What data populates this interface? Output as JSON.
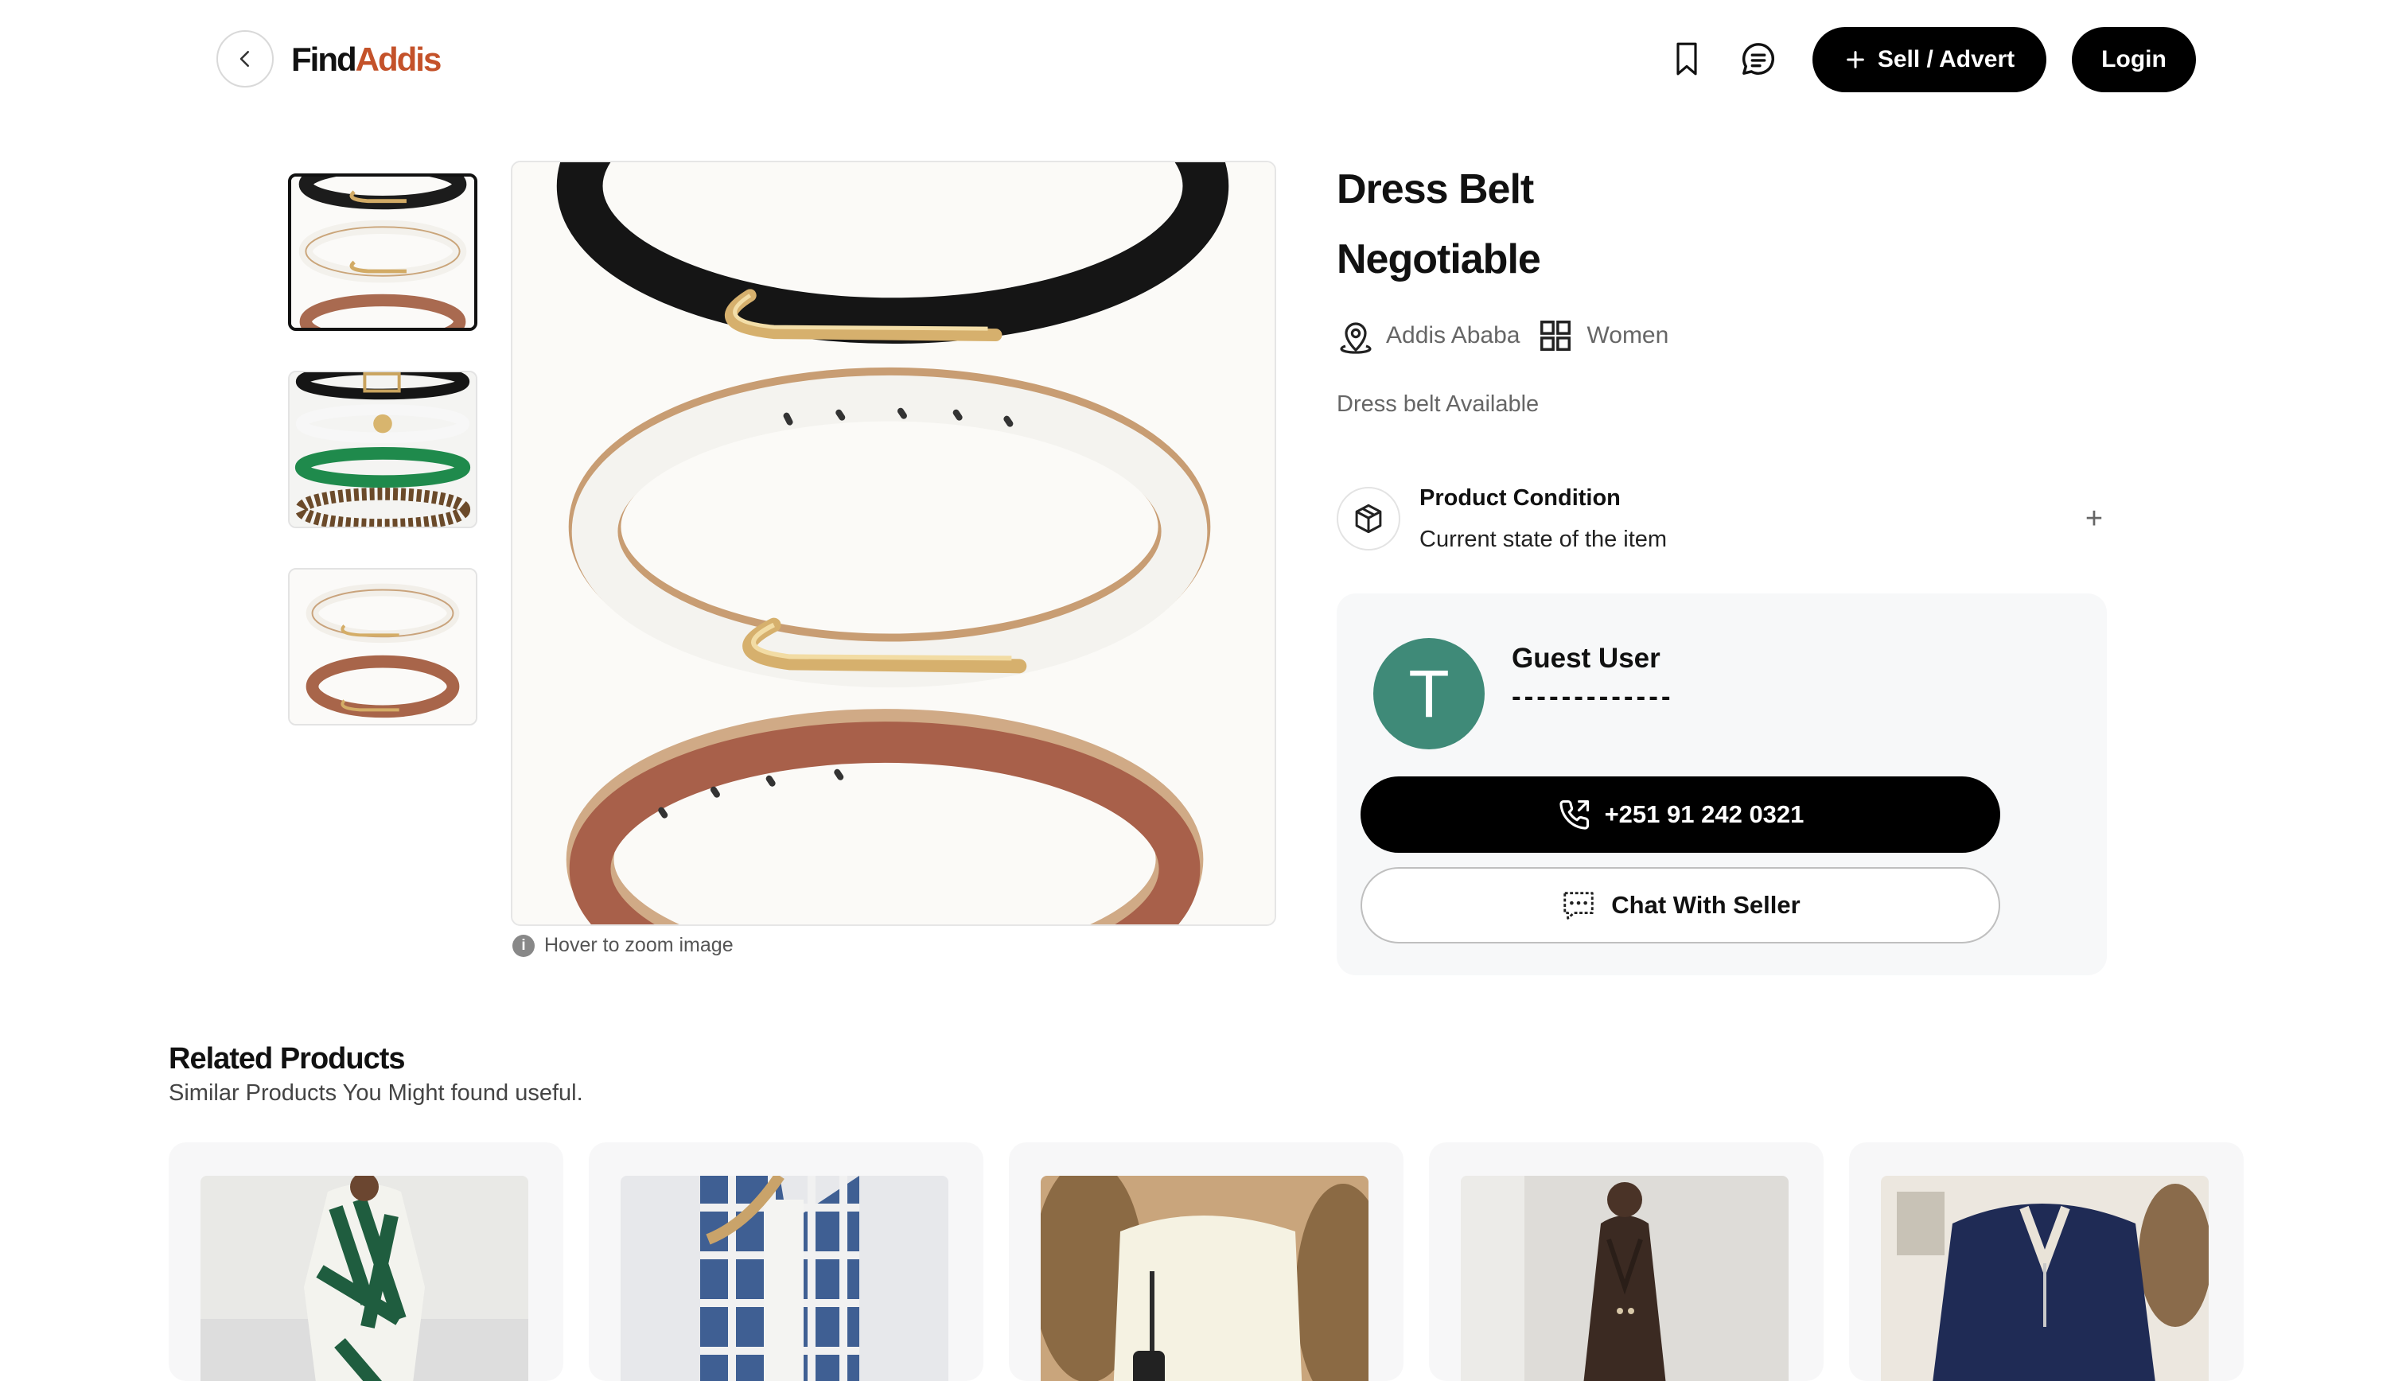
{
  "header": {
    "logo_part1": "Find",
    "logo_part2": "Addis",
    "sell_label": "Sell / Advert",
    "login_label": "Login",
    "icons": [
      "chevron-left-icon",
      "bookmark-icon",
      "message-icon",
      "plus-icon"
    ],
    "brand_color": "#c4522a"
  },
  "gallery": {
    "thumbnail_count": 3,
    "active_thumbnail": 1,
    "zoom_hint": "Hover to zoom image",
    "info_icon_glyph": "i"
  },
  "product": {
    "title": "Dress Belt",
    "price": "Negotiable",
    "location": "Addis Ababa",
    "category": "Women",
    "description": "Dress belt Available",
    "condition_title": "Product Condition",
    "condition_subtitle": "Current state of the item",
    "expand_glyph": "+"
  },
  "seller": {
    "initial": "T",
    "name": "Guest User",
    "placeholder": "-------------",
    "phone": "+251 91 242 0321",
    "chat_label": "Chat With Seller",
    "avatar_color": "#3f8a78"
  },
  "related": {
    "title": "Related Products",
    "subtitle": "Similar Products You Might found useful.",
    "count": 5
  }
}
